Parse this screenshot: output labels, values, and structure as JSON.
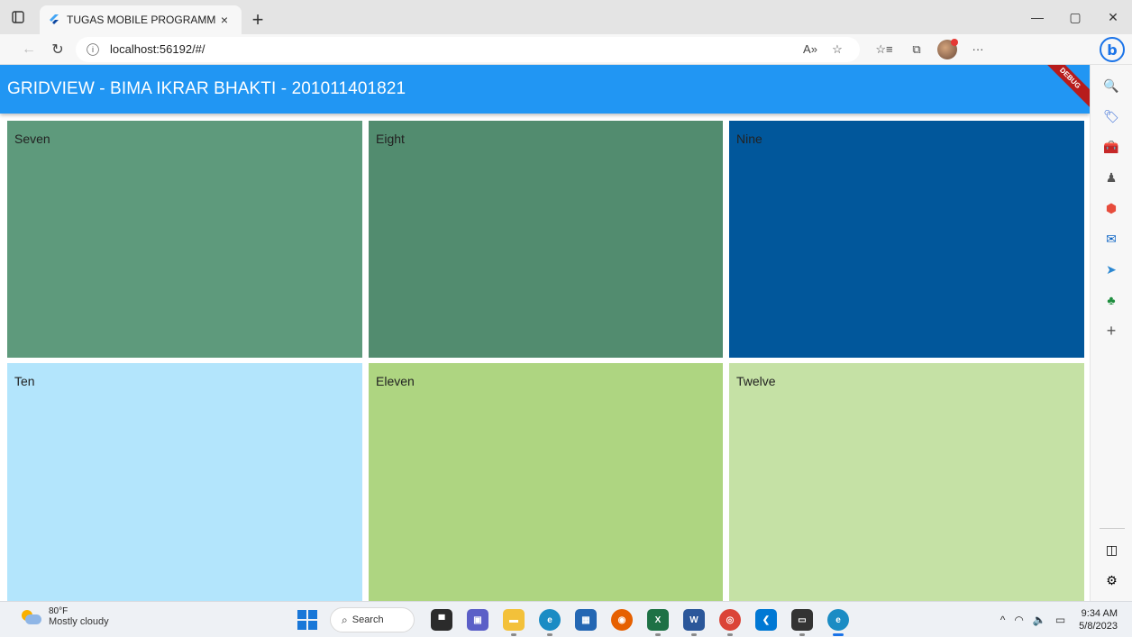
{
  "browser": {
    "tab_title": "TUGAS MOBILE PROGRAMMING",
    "tab_close": "×",
    "new_tab": "+",
    "url": "localhost:56192/#/",
    "window_controls": {
      "minimize": "—",
      "restore": "▢",
      "close": "✕"
    },
    "nav": {
      "back": "←",
      "reload": "↻"
    },
    "address_icons": {
      "read_aloud": "A»",
      "favorite": "☆",
      "favorites": "☆≡",
      "collections": "⧉",
      "more": "···"
    },
    "bing": "b"
  },
  "app": {
    "title": "GRIDVIEW - BIMA IKRAR BHAKTI - 201011401821",
    "debug_banner": "DEBUG",
    "appbar_color": "#2196f3",
    "grid_items": [
      {
        "label": "Seven",
        "color": "#5e9a7c"
      },
      {
        "label": "Eight",
        "color": "#528c6f"
      },
      {
        "label": "Nine",
        "color": "#01579b"
      },
      {
        "label": "Ten",
        "color": "#b3e5fc"
      },
      {
        "label": "Eleven",
        "color": "#aed581"
      },
      {
        "label": "Twelve",
        "color": "#c5e1a5"
      }
    ]
  },
  "sidebar": {
    "items": [
      {
        "name": "search-icon",
        "glyph": "🔍"
      },
      {
        "name": "shopping-tag-icon",
        "glyph": "🏷"
      },
      {
        "name": "tools-icon",
        "glyph": "🧰"
      },
      {
        "name": "games-icon",
        "glyph": "♟"
      },
      {
        "name": "office-icon",
        "glyph": "⬢"
      },
      {
        "name": "outlook-icon",
        "glyph": "✉"
      },
      {
        "name": "send-icon",
        "glyph": "➤"
      },
      {
        "name": "tree-icon",
        "glyph": "♣"
      },
      {
        "name": "add-icon",
        "glyph": "+"
      }
    ],
    "bottom": {
      "split_screen": "◫",
      "settings": "⚙"
    }
  },
  "taskbar": {
    "weather_temp": "80°F",
    "weather_desc": "Mostly cloudy",
    "search_label": "Search",
    "search_glyph": "⌕",
    "apps": [
      {
        "name": "task-view-icon",
        "glyph": "▀",
        "bg": "#2b2b2b",
        "state": ""
      },
      {
        "name": "chat-icon",
        "glyph": "▣",
        "bg": "#5b5fc7",
        "state": ""
      },
      {
        "name": "file-explorer-icon",
        "glyph": "▬",
        "bg": "#f3c13a",
        "state": "running"
      },
      {
        "name": "edge-icon",
        "glyph": "e",
        "bg": "#1b8cc4",
        "state": "running"
      },
      {
        "name": "store-icon",
        "glyph": "▦",
        "bg": "#2467b3",
        "state": ""
      },
      {
        "name": "firefox-icon",
        "glyph": "◉",
        "bg": "#e66000",
        "state": ""
      },
      {
        "name": "excel-icon",
        "glyph": "X",
        "bg": "#1e7145",
        "state": "running"
      },
      {
        "name": "word-icon",
        "glyph": "W",
        "bg": "#2b579a",
        "state": "running"
      },
      {
        "name": "chrome-icon",
        "glyph": "◎",
        "bg": "#db4437",
        "state": "running"
      },
      {
        "name": "vscode-icon",
        "glyph": "❮",
        "bg": "#0078d4",
        "state": ""
      },
      {
        "name": "terminal-icon",
        "glyph": "▭",
        "bg": "#333333",
        "state": "running"
      },
      {
        "name": "edge-dev-icon",
        "glyph": "e",
        "bg": "#1b8cc4",
        "state": "active"
      }
    ],
    "tray": {
      "chevron": "^",
      "wifi": "◠",
      "volume": "🔈",
      "battery": "▭"
    },
    "time": "9:34 AM",
    "date": "5/8/2023"
  }
}
